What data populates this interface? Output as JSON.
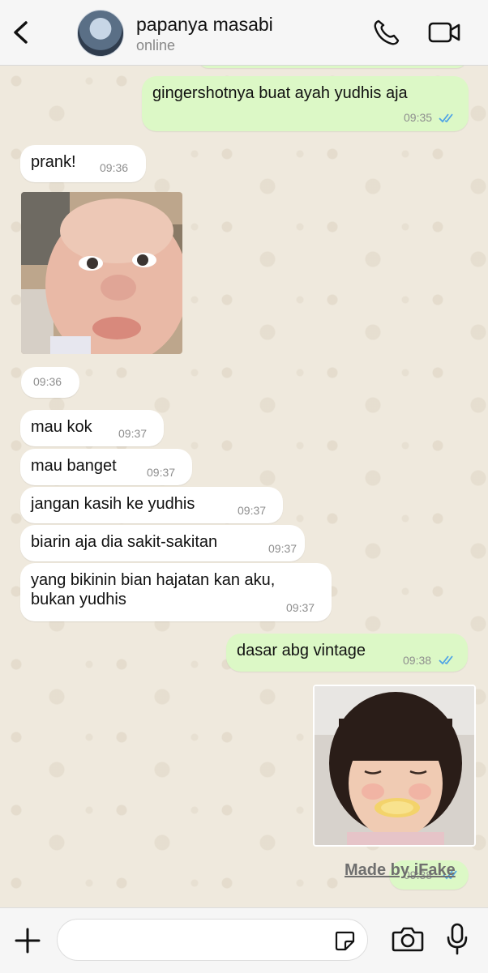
{
  "header": {
    "contact_name": "papanya masabi",
    "status": "online"
  },
  "messages": [
    {
      "direction": "out",
      "text": "gingershotnya buat ayah yudhis aja",
      "time": "09:35",
      "read": true
    },
    {
      "direction": "in",
      "text": "prank!",
      "time": "09:36"
    },
    {
      "direction": "in",
      "type": "image",
      "subject": "baby face sticker",
      "time": "09:36"
    },
    {
      "direction": "in",
      "text": "mau kok",
      "time": "09:37"
    },
    {
      "direction": "in",
      "text": "mau banget",
      "time": "09:37"
    },
    {
      "direction": "in",
      "text": "jangan kasih ke yudhis",
      "time": "09:37"
    },
    {
      "direction": "in",
      "text": "biarin aja dia sakit-sakitan",
      "time": "09:37"
    },
    {
      "direction": "in",
      "text": "yang bikinin bian hajatan kan aku,\nbukan yudhis",
      "time": "09:37"
    },
    {
      "direction": "out",
      "text": "dasar abg vintage",
      "time": "09:38",
      "read": true
    },
    {
      "direction": "out",
      "type": "image",
      "subject": "girl with bangs eating snack sticker",
      "time": "09:38",
      "read": true
    }
  ],
  "watermark": "Made by iFake",
  "icons": {
    "back": "chevron-left-icon",
    "call": "phone-icon",
    "video": "video-camera-icon",
    "attach": "plus-icon",
    "sticker": "sticker-icon",
    "camera": "camera-icon",
    "mic": "microphone-icon"
  },
  "colors": {
    "outgoing_bubble": "#dcf8c6",
    "incoming_bubble": "#ffffff",
    "read_ticks": "#4fa3e6",
    "chat_background": "#efe9dd"
  }
}
